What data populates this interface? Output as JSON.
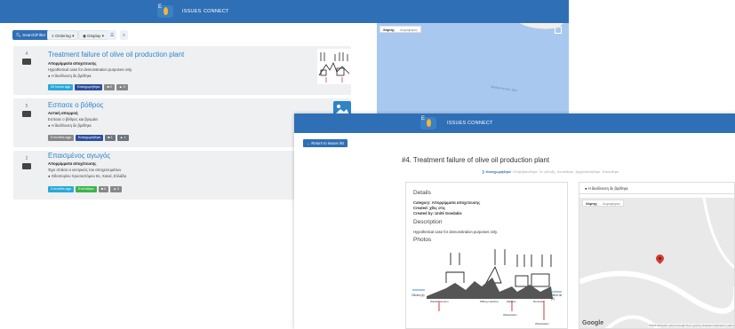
{
  "app": {
    "logo_text": "E",
    "nav_links": [
      "ISSUES",
      "CONNECT"
    ]
  },
  "toolbar": {
    "search_label": "Search/Filter",
    "ordering_label": "Ordering ▾",
    "display_label": "Display ▾"
  },
  "issues": [
    {
      "votes": "4",
      "title": "Treatment failure of olive oil production plant",
      "category": "Απορρίμματα αποχετευσης",
      "description": "Hypothetical case for demonstration purposes only.",
      "address": "Η διεύθυνση δε βρέθηκε",
      "badges": [
        {
          "text": "20 hours ago",
          "color": "cyan"
        },
        {
          "text": "Καταχωρήθηκε",
          "color": "navy"
        },
        {
          "text": "0",
          "color": "gray"
        },
        {
          "text": "0",
          "color": "gray"
        }
      ]
    },
    {
      "votes": "5",
      "title": "Εσπασε ο βόθρος",
      "category": "Αστική απορροή",
      "description": "Εσπασε ο βόθρος και βρομάει",
      "address": "Η διεύθυνση δε βρέθηκε",
      "badges": [
        {
          "text": "5 months ago",
          "color": "gray"
        },
        {
          "text": "Καταχωρήθηκε",
          "color": "navy"
        },
        {
          "text": "1",
          "color": "dark"
        },
        {
          "text": "1",
          "color": "dark"
        }
      ]
    },
    {
      "votes": "2",
      "title": "Επαισμένος αγωγός",
      "category": "Απορρίμματα αποχέτευσης",
      "description": "Έχει σπάσει ο κεντρικός του αποχετευμάτων",
      "address": "Οδοιπορίου Χρυσοστόμου 61, Χανιά, Ελλάδα",
      "badges": [
        {
          "text": "3 months ago",
          "color": "cyan"
        },
        {
          "text": "Επιλύθηκε",
          "color": "green"
        },
        {
          "text": "0",
          "color": "gray"
        },
        {
          "text": "0",
          "color": "gray"
        }
      ]
    }
  ],
  "map_small": {
    "tabs": [
      "Χάρτης",
      "Δορυφόρος"
    ],
    "sea_label": "Mediterranean Sea"
  },
  "detail": {
    "return_label": "Return to issues list",
    "title": "#4. Treatment failure of olive oil production plant",
    "tabs": [
      "Καταχωρήθηκε",
      "Επιβεβαιώθηκε",
      "Σε εξέλιξη",
      "Ανατέθηκε",
      "Αρχειοθετήθηκε",
      "Επιλύθηκε"
    ],
    "details_heading": "Details",
    "category_line": "Category: Απορρίμματα αποχετευσης",
    "created_line": "Created: χθες στις",
    "created_by_line": "Created by: Unité Goedakis",
    "description_heading": "Description",
    "description_text": "Hypothetical case for demonstration purposes only.",
    "photos_heading": "Photos",
    "address_field": "Η διεύθυνση δε βρέθηκε",
    "map_tabs": [
      "Χάρτης",
      "Δορυφόρος"
    ],
    "google_label": "Google",
    "map_attribution": "©2018 Δεδομένα χάρτη Google   Όροι χρήσης   Αναφορά σφάλματος χάρτη",
    "diagram_labels": {
      "olives_in": "Olives (a)",
      "olive_oil": "Olive oil (2)",
      "washer": "Washer section",
      "mill": "Milling machine",
      "malaxer": "Malaxer",
      "decanter": "Decanter",
      "wastewater": "Wastewater"
    }
  }
}
